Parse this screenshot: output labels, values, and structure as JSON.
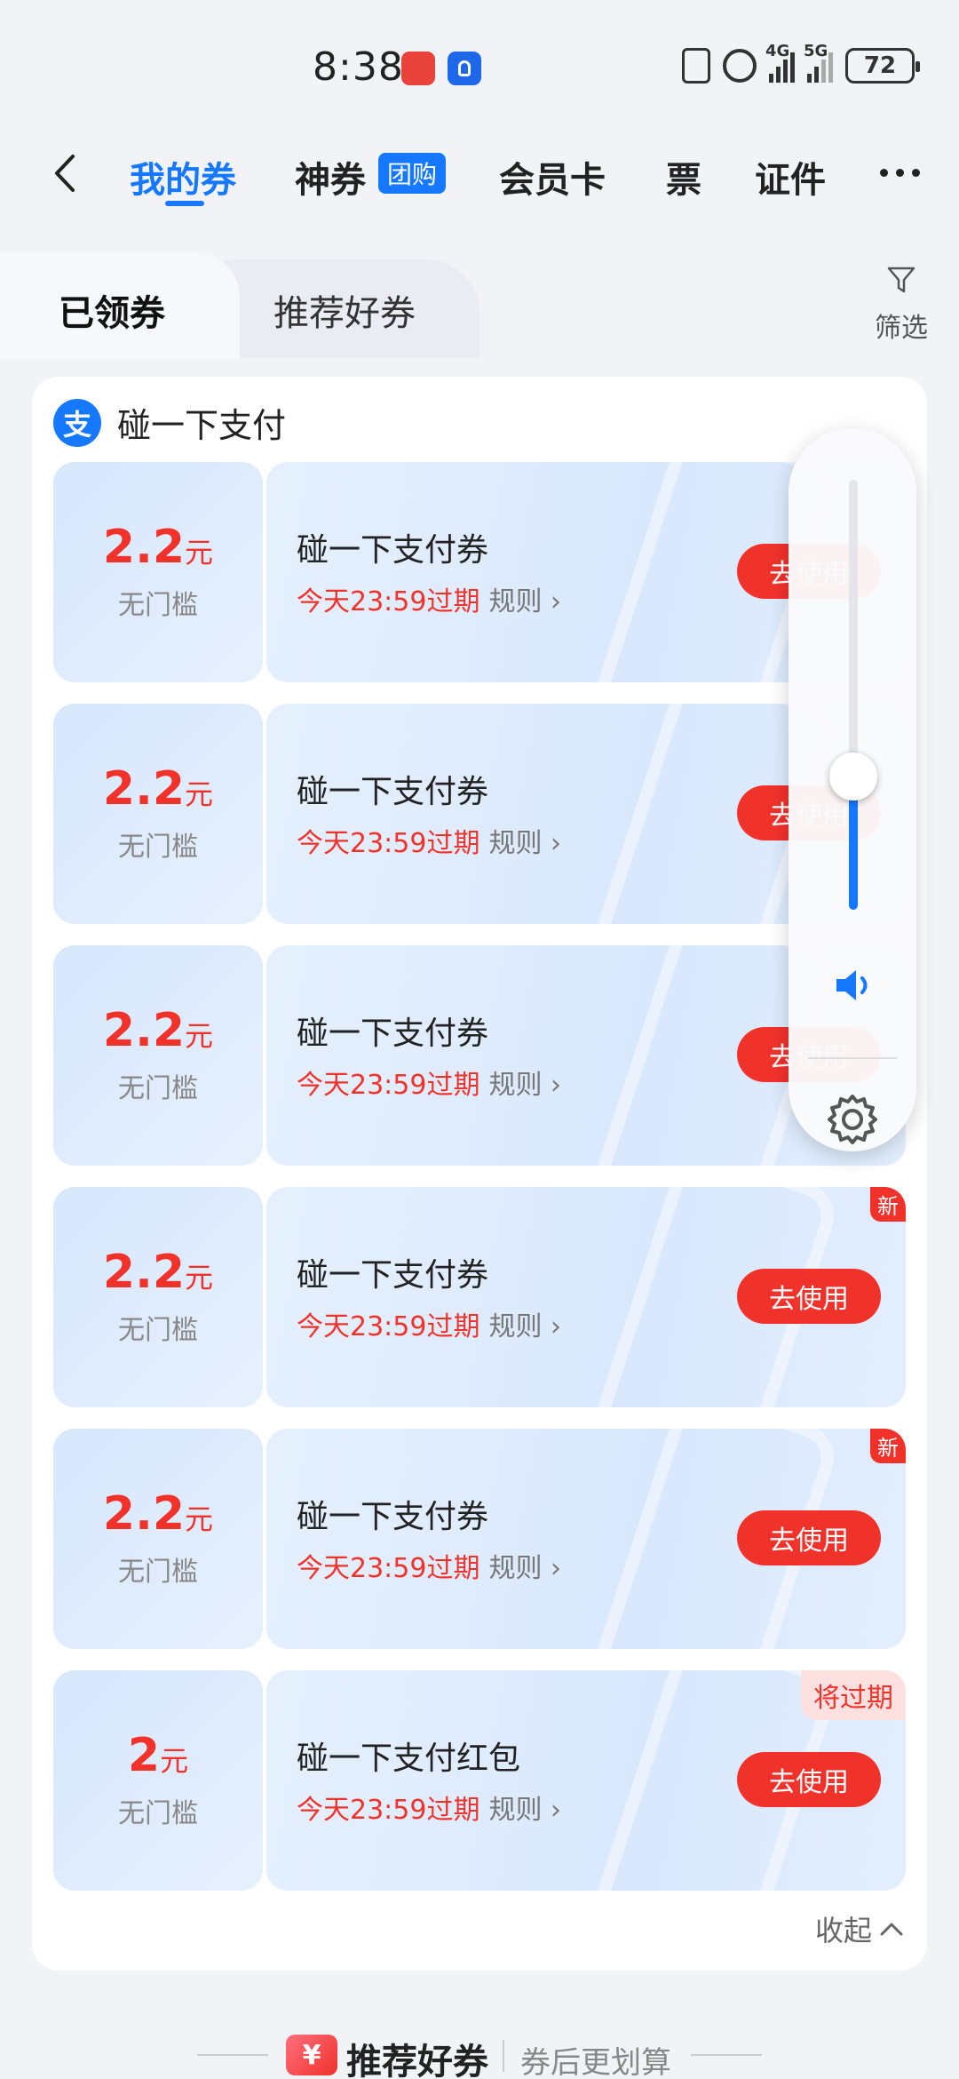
{
  "status_bar": {
    "time": "8:38",
    "battery": "72",
    "sig1": "4G",
    "sig2": "5G"
  },
  "nav": {
    "tabs": [
      {
        "label": "我的券"
      },
      {
        "label": "神券"
      },
      {
        "label": "会员卡"
      },
      {
        "label": "票"
      },
      {
        "label": "证件"
      }
    ],
    "badge": "团购",
    "accent_color": "#1677ff"
  },
  "sub_tabs": {
    "active": "已领券",
    "other": "推荐好券",
    "filter_label": "筛选"
  },
  "merchant": {
    "logo_char": "支",
    "name": "碰一下支付"
  },
  "coupons": [
    {
      "amount": "2.2",
      "unit": "元",
      "threshold": "无门槛",
      "title": "碰一下支付券",
      "expire": "今天23:59过期",
      "rule": "规则",
      "button": "去使用",
      "tag": ""
    },
    {
      "amount": "2.2",
      "unit": "元",
      "threshold": "无门槛",
      "title": "碰一下支付券",
      "expire": "今天23:59过期",
      "rule": "规则",
      "button": "去使用",
      "tag": ""
    },
    {
      "amount": "2.2",
      "unit": "元",
      "threshold": "无门槛",
      "title": "碰一下支付券",
      "expire": "今天23:59过期",
      "rule": "规则",
      "button": "去使用",
      "tag": ""
    },
    {
      "amount": "2.2",
      "unit": "元",
      "threshold": "无门槛",
      "title": "碰一下支付券",
      "expire": "今天23:59过期",
      "rule": "规则",
      "button": "去使用",
      "tag": "新"
    },
    {
      "amount": "2.2",
      "unit": "元",
      "threshold": "无门槛",
      "title": "碰一下支付券",
      "expire": "今天23:59过期",
      "rule": "规则",
      "button": "去使用",
      "tag": "新"
    },
    {
      "amount": "2",
      "unit": "元",
      "threshold": "无门槛",
      "title": "碰一下支付红包",
      "expire": "今天23:59过期",
      "rule": "规则",
      "button": "去使用",
      "tag": "将过期"
    }
  ],
  "collapse_label": "收起",
  "recommend": {
    "icon_char": "¥",
    "title": "推荐好券",
    "subtitle": "券后更划算"
  },
  "volume": {
    "level": 0.31
  },
  "colors": {
    "price_red": "#f0322b",
    "brand_blue": "#1677ff"
  }
}
